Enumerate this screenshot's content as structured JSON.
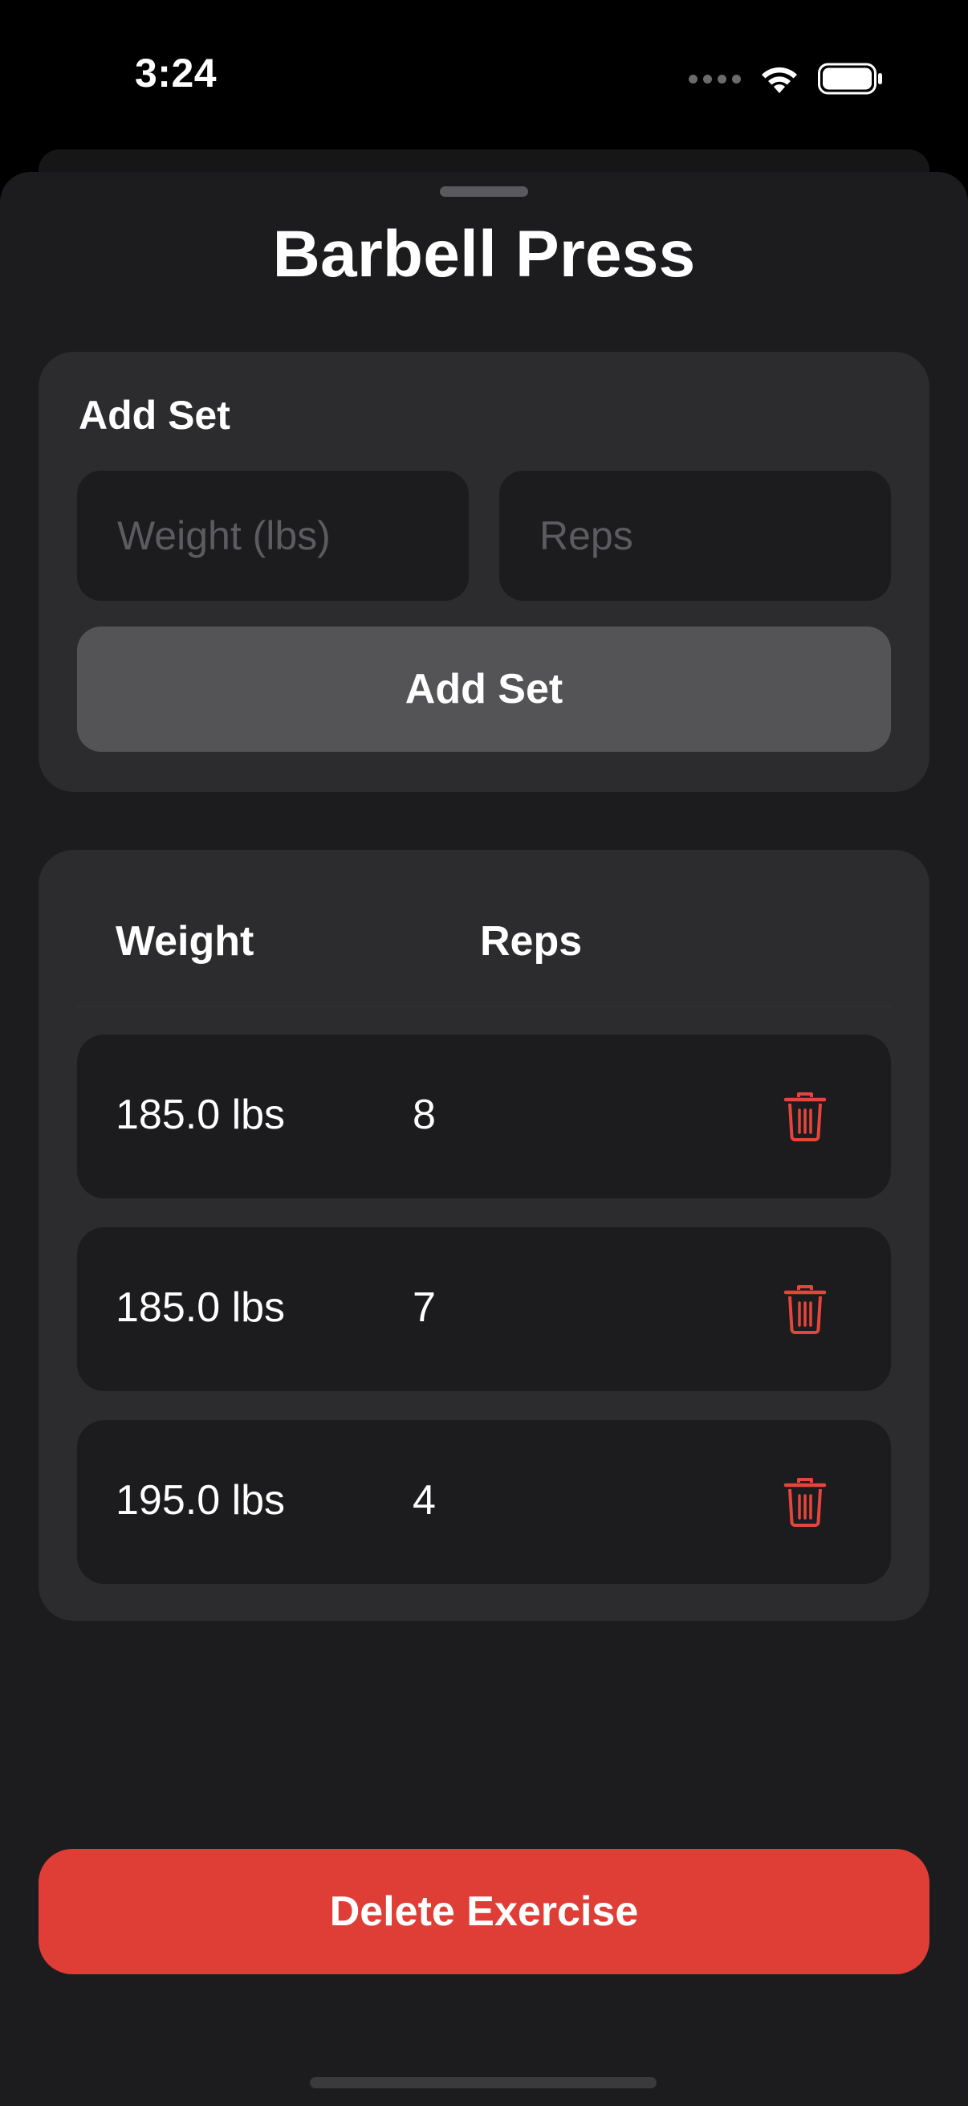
{
  "status_bar": {
    "time": "3:24"
  },
  "sheet": {
    "title": "Barbell Press"
  },
  "add_set": {
    "heading": "Add Set",
    "weight_placeholder": "Weight (lbs)",
    "reps_placeholder": "Reps",
    "button_label": "Add Set"
  },
  "sets_table": {
    "columns": [
      "Weight",
      "Reps"
    ],
    "rows": [
      {
        "weight": "185.0 lbs",
        "reps": "8"
      },
      {
        "weight": "185.0 lbs",
        "reps": "7"
      },
      {
        "weight": "195.0 lbs",
        "reps": "4"
      }
    ],
    "row_action_icon": "trash-icon"
  },
  "delete_button_label": "Delete Exercise",
  "colors": {
    "destructive": "#df3e36",
    "card": "#2c2c2e",
    "sheet": "#1c1c1e"
  }
}
